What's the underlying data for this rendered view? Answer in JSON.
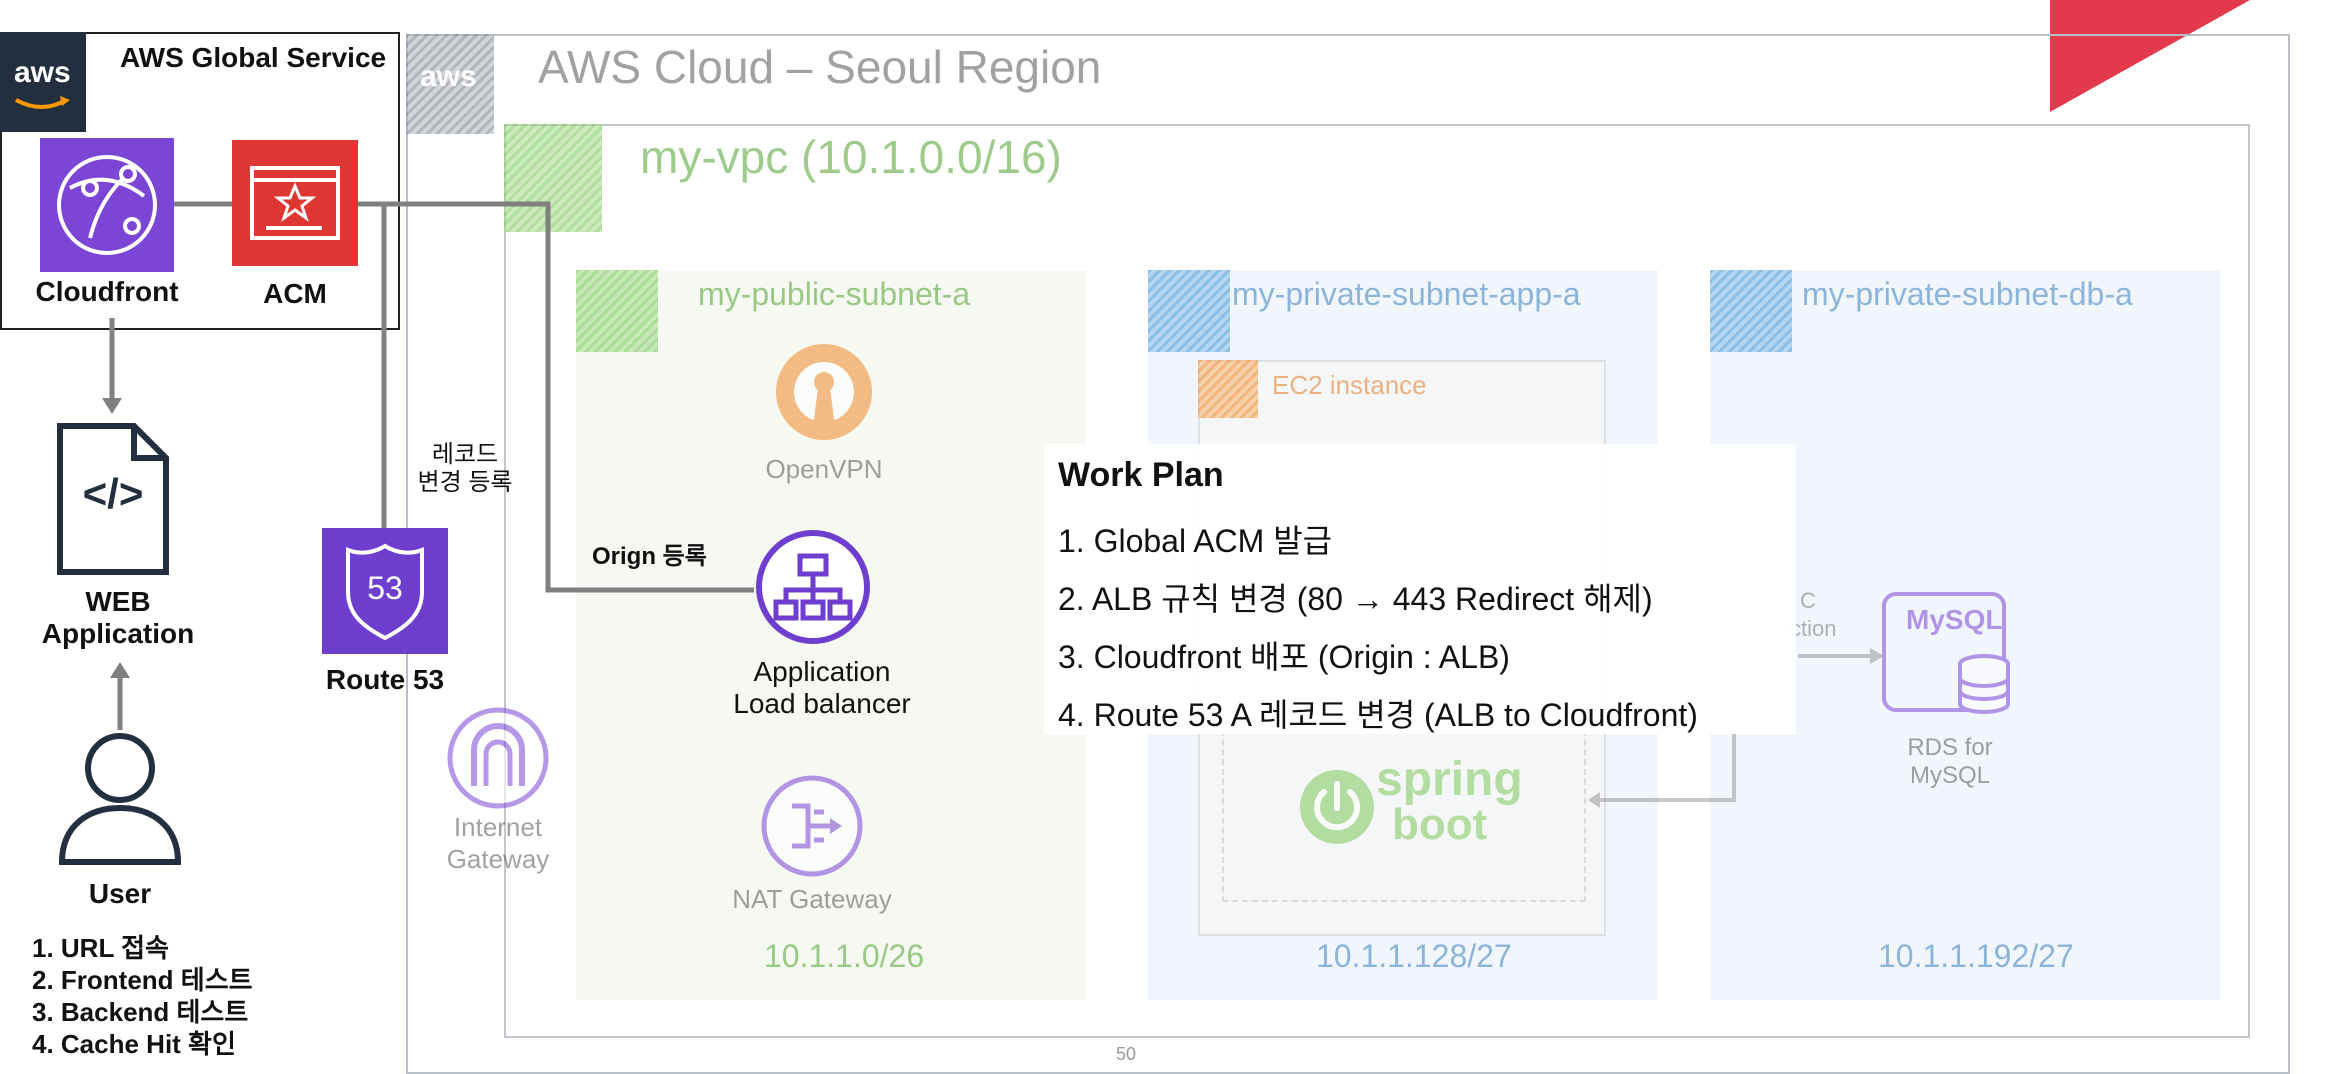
{
  "global": {
    "title": "AWS Global Service",
    "cloudfront_label": "Cloudfront",
    "acm_label": "ACM"
  },
  "cloud": {
    "title": "AWS Cloud – Seoul Region",
    "vpc_title": "my-vpc (10.1.0.0/16)"
  },
  "subnets": {
    "public": {
      "name": "my-public-subnet-a",
      "cidr": "10.1.1.0/26"
    },
    "app": {
      "name": "my-private-subnet-app-a",
      "cidr": "10.1.1.128/27"
    },
    "db": {
      "name": "my-private-subnet-db-a",
      "cidr": "10.1.1.192/27"
    }
  },
  "services": {
    "openvpn": "OpenVPN",
    "alb_line1": "Application",
    "alb_line2": "Load balancer",
    "nat": "NAT Gateway",
    "igw_line1": "Internet",
    "igw_line2": "Gateway",
    "ec2": "EC2 instance",
    "spring_line1": "spring",
    "spring_line2": "boot",
    "mysql": "MySQL",
    "rds_line1": "RDS for",
    "rds_line2": "MySQL",
    "route53": "Route 53",
    "route53_badge": "53",
    "conn_frag1": "C",
    "conn_frag2": "ction"
  },
  "annotations": {
    "record_line1": "레코드",
    "record_line2": "변경 등록",
    "origin": "Orign 등록"
  },
  "web_app": {
    "line1": "WEB",
    "line2": "Application",
    "code_glyph": "</>"
  },
  "user": {
    "label": "User",
    "steps": [
      "1.   URL  접속",
      "2.   Frontend 테스트",
      "3.   Backend 테스트",
      "4.   Cache Hit 확인"
    ]
  },
  "work_plan": {
    "title": "Work Plan",
    "items": [
      "1.   Global ACM 발급",
      "2.   ALB 규칙 변경 (80 → 443 Redirect 해제)",
      "3.   Cloudfront 배포  (Origin : ALB)",
      "4.   Route 53 A 레코드 변경 (ALB to Cloudfront)"
    ]
  },
  "footer": {
    "page_number": "50"
  },
  "colors": {
    "aws_dark": "#232f3e",
    "cloudfront_purple": "#7b45d6",
    "acm_red": "#dd3633",
    "route53_purple": "#6e3fcf",
    "vpc_green": "#7cc85a",
    "private_blue": "#4a98d8",
    "ec2_orange": "#f08a2c",
    "corner_red": "#e2394c"
  }
}
